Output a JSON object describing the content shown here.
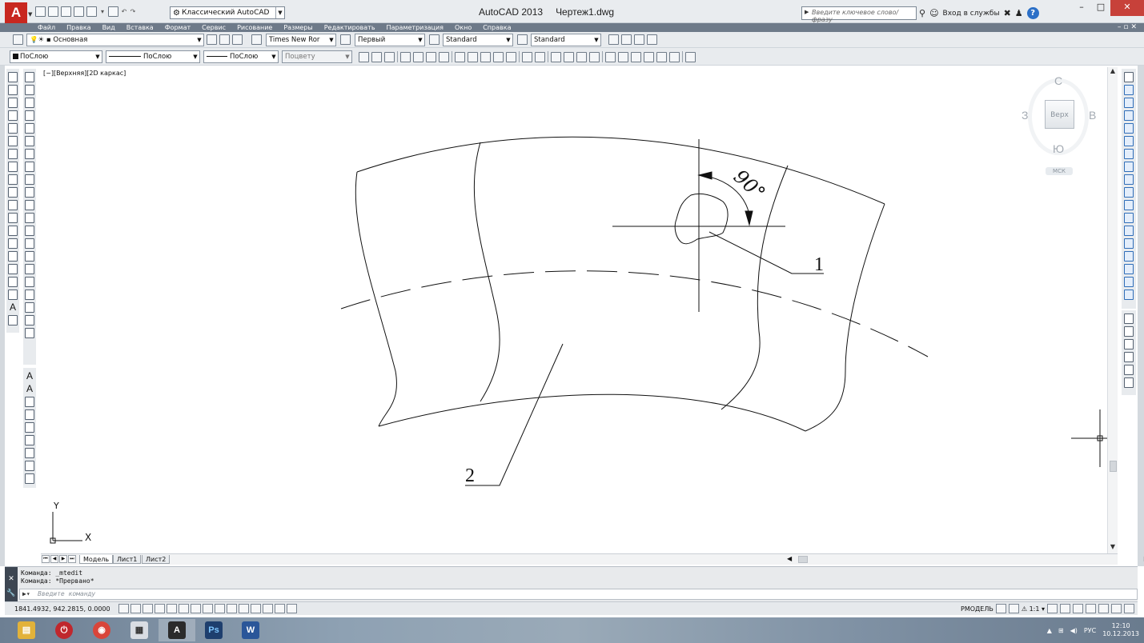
{
  "app": {
    "title": "AutoCAD 2013",
    "document": "Чертеж1.dwg",
    "logo": "A",
    "workspace": "Классический AutoCAD"
  },
  "search": {
    "placeholder": "Введите ключевое слово/фразу"
  },
  "account": {
    "sign_in": "Вход в службы"
  },
  "menu": [
    "Файл",
    "Правка",
    "Вид",
    "Вставка",
    "Формат",
    "Сервис",
    "Рисование",
    "Размеры",
    "Редактировать",
    "Параметризация",
    "Окно",
    "Справка"
  ],
  "toolbar1": {
    "layer": "Основная",
    "text_font": "Times New Ror",
    "text_style_dim": "Первый",
    "dim_style": "Standard",
    "table_style": "Standard"
  },
  "toolbar2": {
    "color": "ПоСлою",
    "linetype": "ПоСлою",
    "lineweight": "ПоСлою",
    "plotstyle": "Поцвету"
  },
  "viewport": {
    "label": "[−][Верхняя][2D каркас]"
  },
  "viewcube": {
    "top": "Верх",
    "north": "С",
    "south": "Ю",
    "west": "З",
    "east": "В",
    "ucs": "МСК"
  },
  "drawing": {
    "angle_label": "90°",
    "callout_1": "1",
    "callout_2": "2",
    "ucs_x": "X",
    "ucs_y": "Y"
  },
  "layout_tabs": [
    "Модель",
    "Лист1",
    "Лист2"
  ],
  "command": {
    "history": [
      "Команда: _mtedit",
      "Команда: *Прервано*"
    ],
    "placeholder": "Введите команду"
  },
  "status": {
    "coordinates": "1841.4932, 942.2815, 0.0000",
    "model": "РМОДЕЛЬ",
    "scale": "1:1"
  },
  "taskbar": {
    "lang": "РУС",
    "time": "12:10",
    "date": "10.12.2013"
  },
  "colors": {
    "title_close": "#c7413a",
    "menu_bg": "#6e7a89",
    "logo": "#c8271f"
  }
}
